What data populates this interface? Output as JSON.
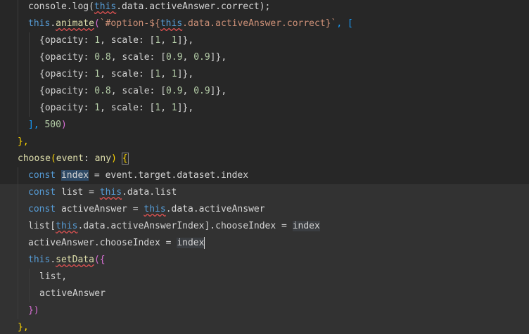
{
  "editor": {
    "theme": {
      "background": "#272727",
      "keyword": "#569cd6",
      "function": "#dcdcaa",
      "string": "#ce9178",
      "number": "#b5cea8"
    },
    "lines": [
      [
        "console.log(",
        "this",
        ".data.activeAnswer.correct);"
      ],
      [
        "this",
        ".",
        "animate",
        "(",
        "`#option-${",
        "this",
        ".data.activeAnswer.correct}`",
        ", ["
      ],
      [
        "{opacity: ",
        "1",
        ", scale: [",
        "1",
        ", ",
        "1",
        "]},"
      ],
      [
        "{opacity: ",
        "0.8",
        ", scale: [",
        "0.9",
        ", ",
        "0.9",
        "]},"
      ],
      [
        "{opacity: ",
        "1",
        ", scale: [",
        "1",
        ", ",
        "1",
        "]},"
      ],
      [
        "{opacity: ",
        "0.8",
        ", scale: [",
        "0.9",
        ", ",
        "0.9",
        "]},"
      ],
      [
        "{opacity: ",
        "1",
        ", scale: [",
        "1",
        ", ",
        "1",
        "]},"
      ],
      [
        "], ",
        "500",
        ")"
      ],
      [
        "},"
      ],
      [
        "choose",
        "(",
        "event",
        ": ",
        "any",
        ") ",
        "{"
      ],
      [
        "const",
        " ",
        "index",
        " = event.target.dataset.index"
      ],
      [
        "const",
        " list = ",
        "this",
        ".data.list"
      ],
      [
        "const",
        " activeAnswer = ",
        "this",
        ".data.activeAnswer"
      ],
      [
        "list[",
        "this",
        ".data.activeAnswerIndex].chooseIndex = ",
        "index"
      ],
      [
        "activeAnswer.chooseIndex = ",
        "index"
      ],
      [
        "this",
        ".",
        "setData",
        "({"
      ],
      [
        "list,"
      ],
      [
        "activeAnswer"
      ],
      [
        "})"
      ],
      [
        "},"
      ]
    ]
  }
}
